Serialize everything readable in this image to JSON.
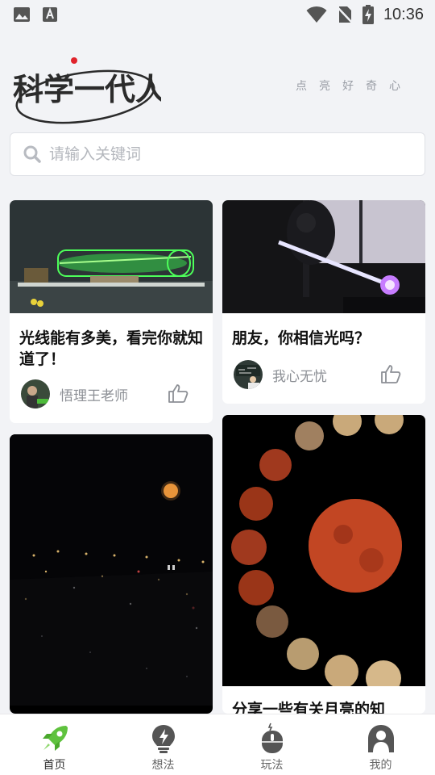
{
  "status_bar": {
    "time": "10:36",
    "icons": [
      "image-icon",
      "a-icon",
      "wifi-icon",
      "no-sim-icon",
      "battery-charging-icon"
    ]
  },
  "header": {
    "logo_text": "科学一代人",
    "tagline": "点亮好奇心"
  },
  "search": {
    "placeholder": "请输入关键词",
    "value": ""
  },
  "cards": [
    {
      "title": "光线能有多美，看完你就知道了！",
      "author": "悟理王老师",
      "image": "green-laser-tube",
      "avatar": "teacher-avatar",
      "like_icon": "thumbs-up-icon"
    },
    {
      "title": "朋友，你相信光吗？",
      "author": "我心无忧",
      "image": "plasma-light-beam",
      "avatar": "blackboard-avatar",
      "like_icon": "thumbs-up-icon"
    },
    {
      "title": "",
      "author": "",
      "image": "moon-over-city-night",
      "like_icon": ""
    },
    {
      "title": "分享一些有关月亮的知",
      "author": "",
      "image": "lunar-eclipse-sequence",
      "like_icon": ""
    }
  ],
  "tabbar": {
    "accent": "#5fc23e",
    "items": [
      {
        "label": "首页",
        "icon": "rocket-icon",
        "active": true
      },
      {
        "label": "想法",
        "icon": "lightbulb-icon",
        "active": false
      },
      {
        "label": "玩法",
        "icon": "mouse-icon",
        "active": false
      },
      {
        "label": "我的",
        "icon": "profile-icon",
        "active": false
      }
    ]
  }
}
